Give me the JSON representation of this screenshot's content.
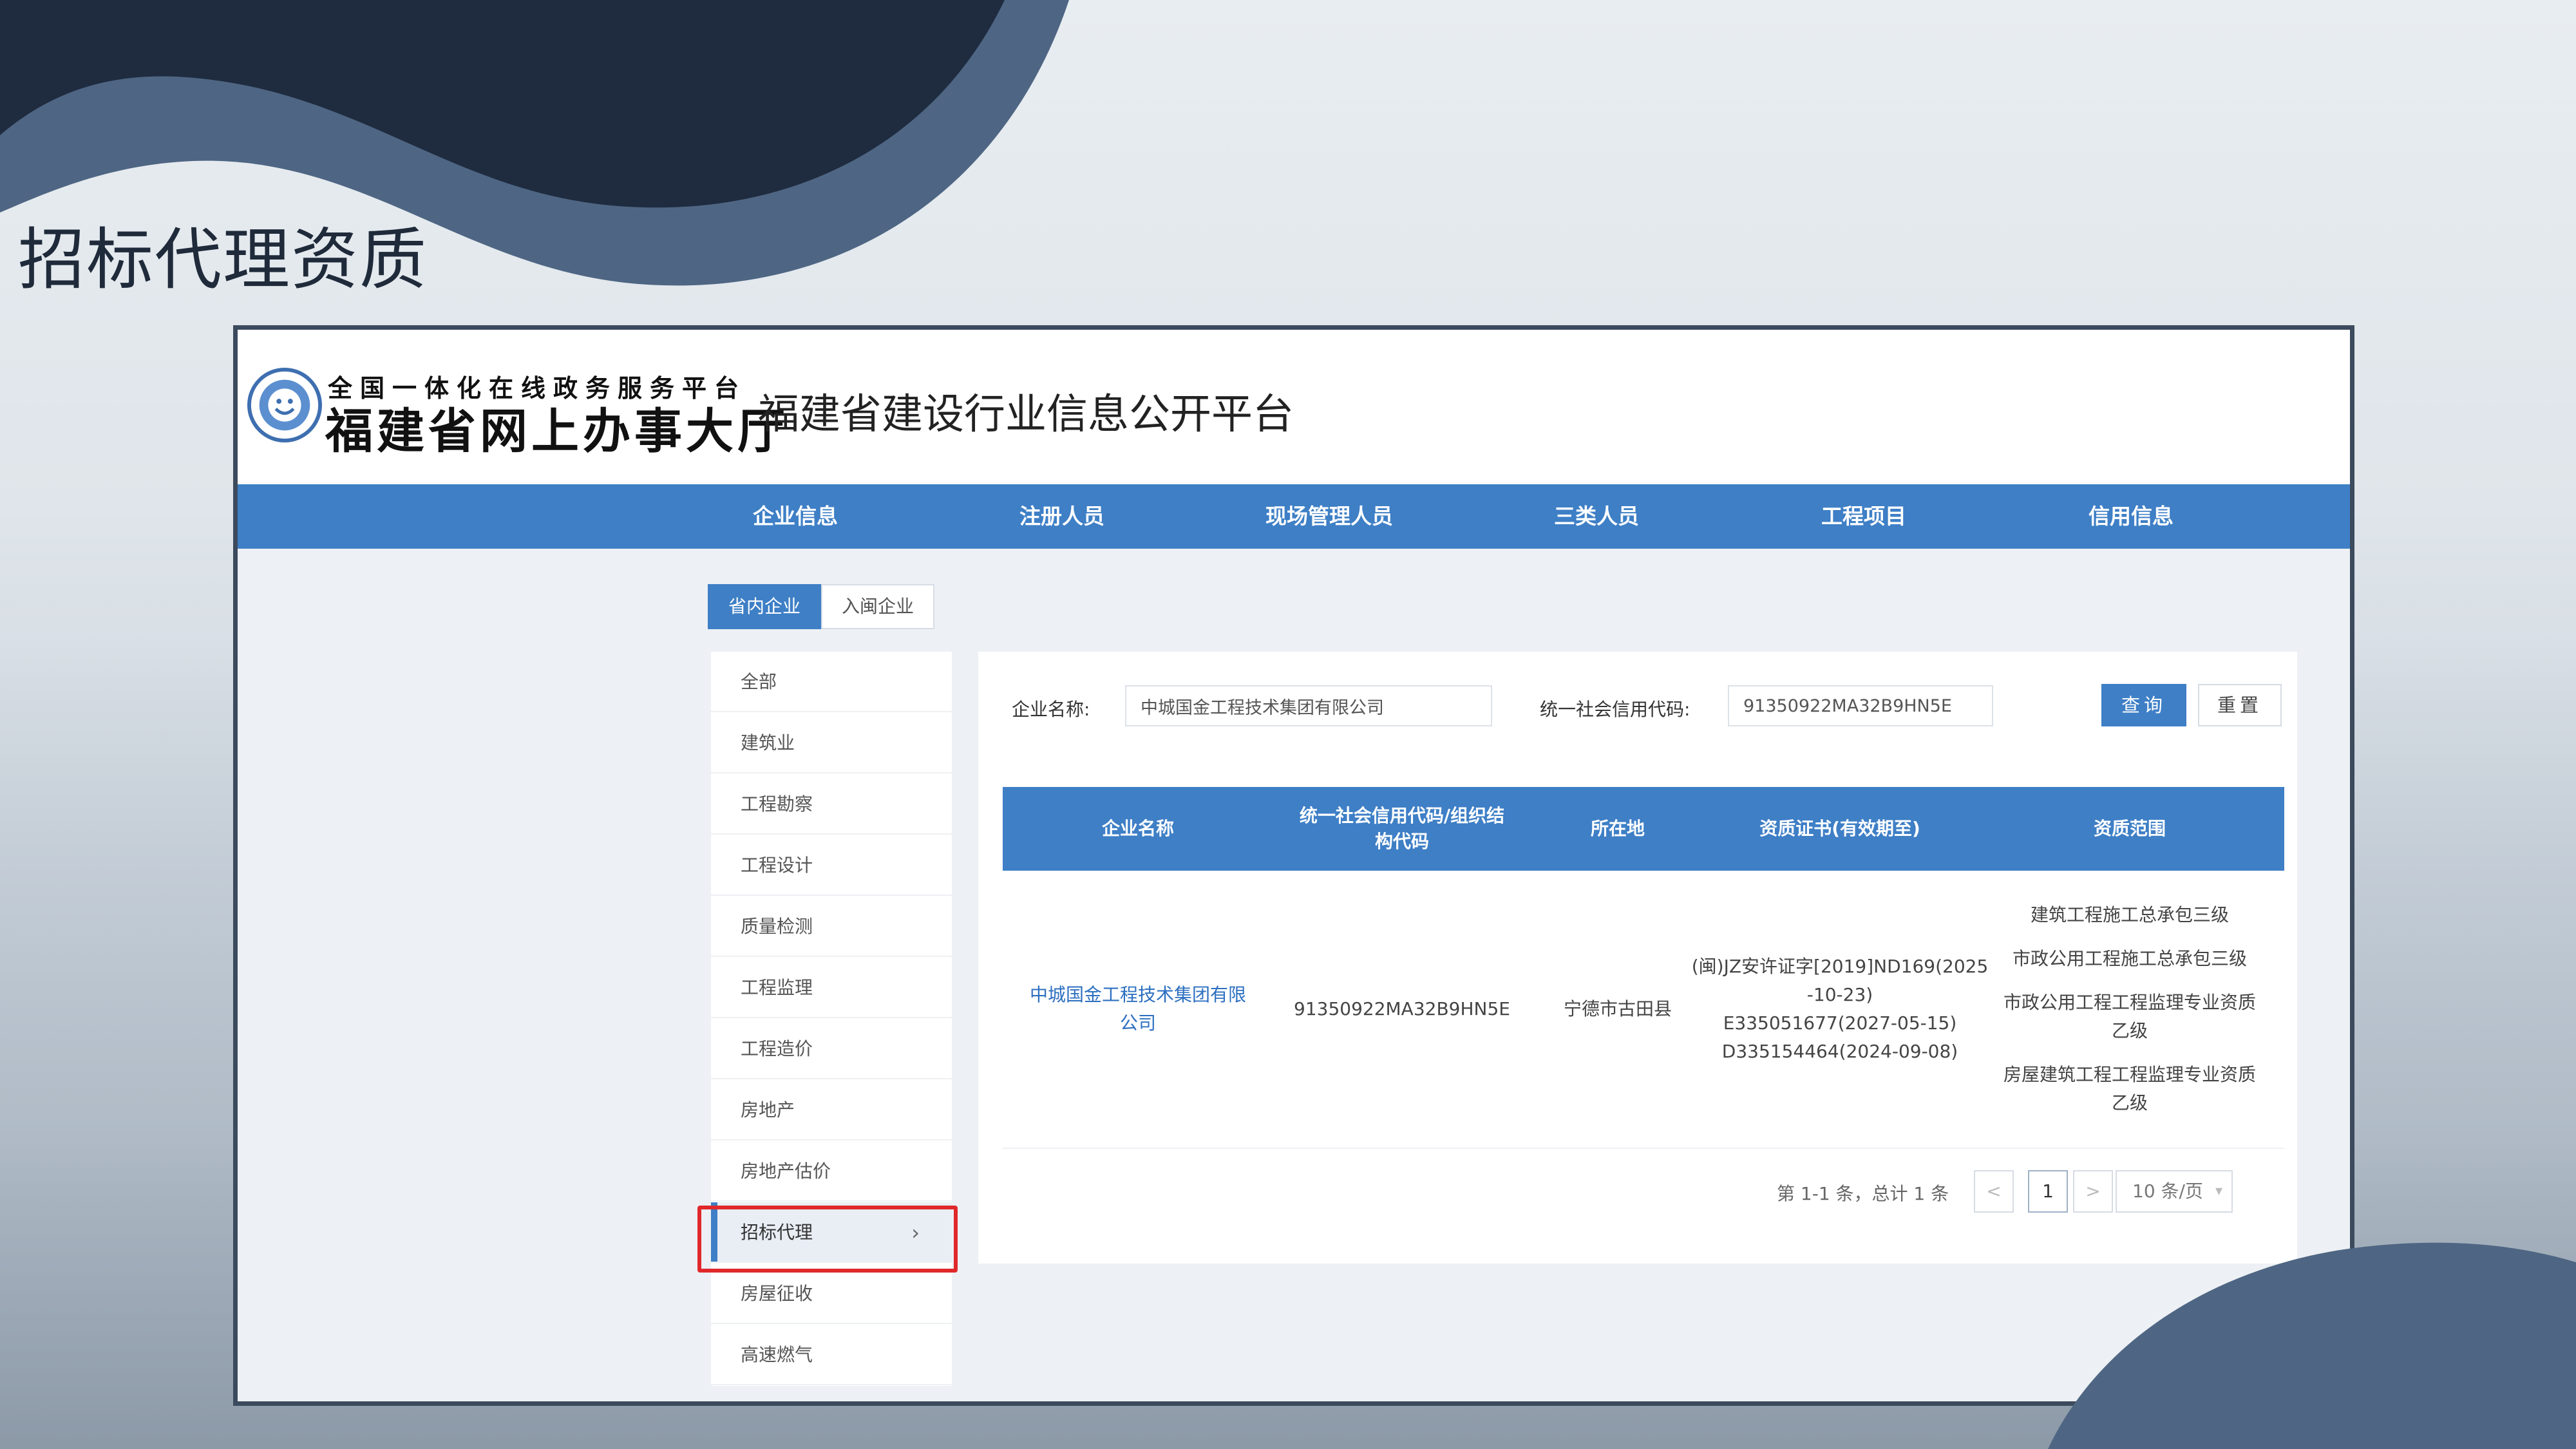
{
  "slide": {
    "title": "招标代理资质"
  },
  "portal": {
    "small_title": "全国一体化在线政务服务平台",
    "big_title": "福建省网上办事大厅",
    "platform_name": "福建省建设行业信息公开平台"
  },
  "nav": [
    "企业信息",
    "注册人员",
    "现场管理人员",
    "三类人员",
    "工程项目",
    "信用信息"
  ],
  "tabs": [
    {
      "label": "省内企业",
      "active": true
    },
    {
      "label": "入闽企业",
      "active": false
    }
  ],
  "categories": [
    "全部",
    "建筑业",
    "工程勘察",
    "工程设计",
    "质量检测",
    "工程监理",
    "工程造价",
    "房地产",
    "房地产估价",
    "招标代理",
    "房屋征收",
    "高速燃气"
  ],
  "active_category": "招标代理",
  "search": {
    "name_label": "企业名称:",
    "name_value": "中城国金工程技术集团有限公司",
    "code_label": "统一社会信用代码:",
    "code_value": "91350922MA32B9HN5E",
    "query_button": "查询",
    "reset_button": "重置"
  },
  "table": {
    "headers": [
      "企业名称",
      "统一社会信用代码/组织结构代码",
      "所在地",
      "资质证书(有效期至)",
      "资质范围"
    ],
    "rows": [
      {
        "company": "中城国金工程技术集团有限公司",
        "code": "91350922MA32B9HN5E",
        "location": "宁德市古田县",
        "certs": [
          "(闽)JZ安许证字[2019]ND169(2025",
          "-10-23)",
          "E335051677(2027-05-15)",
          "D335154464(2024-09-08)"
        ],
        "scopes": [
          "建筑工程施工总承包三级",
          "市政公用工程施工总承包三级",
          "市政公用工程工程监理专业资质乙级",
          "房屋建筑工程工程监理专业资质乙级"
        ]
      }
    ]
  },
  "pagination": {
    "info": "第 1-1 条，总计 1 条",
    "current_page": "1",
    "prev": "<",
    "next": ">",
    "page_size": "10 条/页"
  },
  "colors": {
    "primary": "#3e7fc6",
    "highlight": "#e0282b",
    "dark_blob": "#1f2b3f",
    "mid_blob": "#4e6683"
  }
}
